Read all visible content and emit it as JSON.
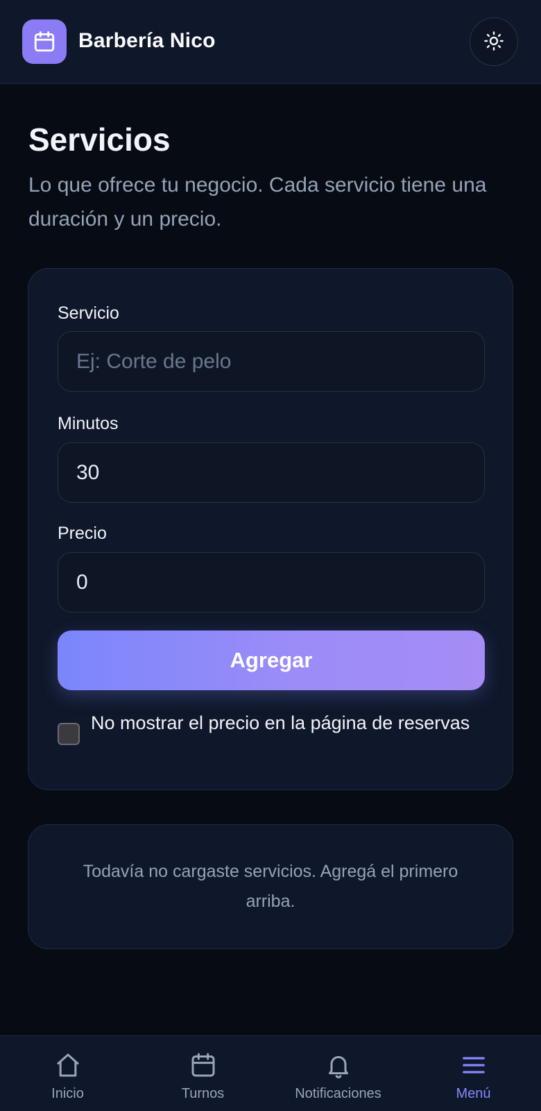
{
  "header": {
    "app_name": "Barbería Nico",
    "brand_icon": "calendar-icon",
    "theme_icon": "sun-icon",
    "accent": "#8b7cf6"
  },
  "page": {
    "title": "Servicios",
    "subtitle": "Lo que ofrece tu negocio. Cada servicio tiene una duración y un precio."
  },
  "form": {
    "service_label": "Servicio",
    "service_placeholder": "Ej: Corte de pelo",
    "service_value": "",
    "minutes_label": "Minutos",
    "minutes_value": "30",
    "price_label": "Precio",
    "price_value": "0",
    "submit_label": "Agregar",
    "hide_price_label": "No mostrar el precio en la página de reservas",
    "hide_price_checked": false
  },
  "empty_state": {
    "text": "Todavía no cargaste servicios. Agregá el primero arriba."
  },
  "nav": {
    "items": [
      {
        "label": "Inicio",
        "icon": "home-icon",
        "active": false
      },
      {
        "label": "Turnos",
        "icon": "calendar-icon",
        "active": false
      },
      {
        "label": "Notificaciones",
        "icon": "bell-icon",
        "active": false
      },
      {
        "label": "Menú",
        "icon": "menu-icon",
        "active": true
      }
    ],
    "active_color": "#8a86ff"
  }
}
